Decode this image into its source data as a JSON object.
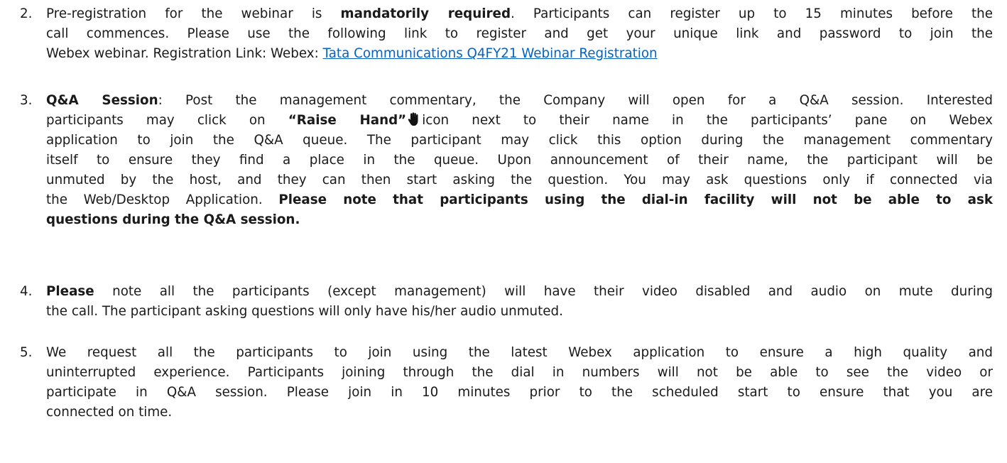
{
  "items": [
    {
      "number": "2.",
      "lines": [
        [
          "Pre-registration for the webinar is ",
          {
            "b": "mandatorily required"
          },
          ". Participants can register up to 15 minutes before the"
        ],
        [
          "call commences. Please use the following link to register and get your unique link and password to join the"
        ],
        [
          "Webex webinar. Registration Link: Webex: ",
          {
            "link": "Tata Communications Q4FY21 Webinar Registration"
          }
        ]
      ]
    },
    {
      "number": "3.",
      "lines": [
        [
          {
            "b": "Q&A Session"
          },
          ": Post the management commentary, the Company will open for a Q&A session. Interested"
        ],
        [
          "participants may click on ",
          {
            "b": "“Raise Hand”"
          },
          {
            "icon": "raise-hand-icon"
          },
          "icon next to their name in the participants’ pane on Webex"
        ],
        [
          "application to join the Q&A queue. The participant may click this option during the management commentary"
        ],
        [
          "itself to ensure they find a place in the queue. Upon announcement of their name, the participant will be"
        ],
        [
          "unmuted by the host, and they can then start asking the question. You may ask questions only if connected via"
        ],
        [
          "the Web/Desktop Application. ",
          {
            "b": "Please note that participants using the dial-in facility will not be able to ask"
          }
        ],
        [
          {
            "b": "questions during the Q&A session."
          }
        ]
      ]
    },
    {
      "number": "4.",
      "lines": [
        [
          {
            "b": "Please"
          },
          " note all the participants (except management) will have their video disabled and audio on mute during"
        ],
        [
          "the call. The participant asking questions will only have his/her audio unmuted."
        ]
      ]
    },
    {
      "number": "5.",
      "lines": [
        [
          "We request all the participants to join using the latest Webex application to ensure a high quality and"
        ],
        [
          "uninterrupted experience. Participants joining through the dial in numbers will not be able to see the video or"
        ],
        [
          "participate in Q&A session. Please join in 10 minutes prior to the scheduled start to ensure that you are"
        ],
        [
          "connected on time."
        ]
      ]
    }
  ],
  "colors": {
    "text": "#1a1a1a",
    "link": "#0563c1"
  }
}
